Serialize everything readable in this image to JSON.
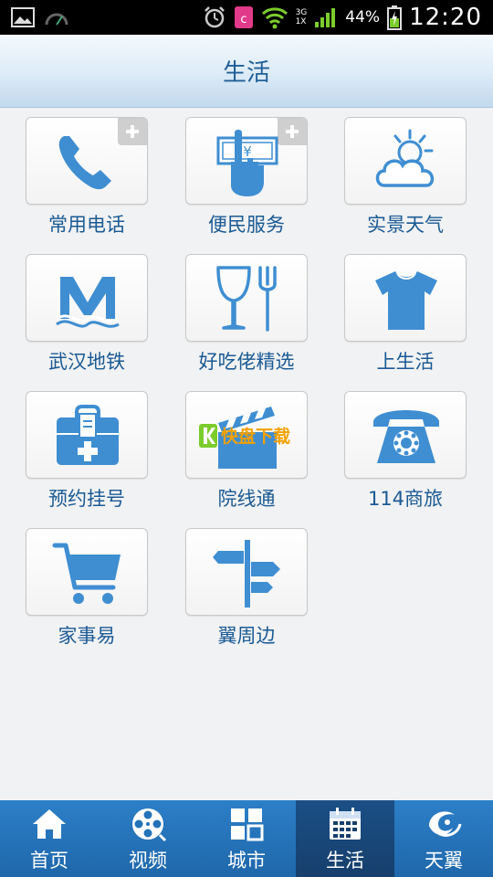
{
  "status_bar": {
    "battery_percent": "44%",
    "time": "12:20",
    "network_labels": [
      "3G",
      "1X"
    ],
    "icons": [
      "image-icon",
      "speedometer-icon",
      "alarm-clock-icon",
      "app-badge-icon",
      "wifi-icon",
      "signal-icon",
      "battery-icon"
    ]
  },
  "header": {
    "title": "生活"
  },
  "tiles": [
    {
      "label": "常用电话",
      "icon": "phone-handset-icon",
      "plus": true
    },
    {
      "label": "便民服务",
      "icon": "hand-with-yen-icon",
      "plus": true
    },
    {
      "label": "实景天气",
      "icon": "weather-sun-cloud-icon",
      "plus": false
    },
    {
      "label": "武汉地铁",
      "icon": "metro-m-icon",
      "plus": false
    },
    {
      "label": "好吃佬精选",
      "icon": "glass-fork-icon",
      "plus": false
    },
    {
      "label": "上生活",
      "icon": "tshirt-icon",
      "plus": false
    },
    {
      "label": "预约挂号",
      "icon": "medical-kit-icon",
      "plus": false
    },
    {
      "label": "院线通",
      "icon": "clapperboard-icon",
      "plus": false
    },
    {
      "label": "114商旅",
      "icon": "rotary-phone-icon",
      "plus": false
    },
    {
      "label": "家事易",
      "icon": "shopping-cart-icon",
      "plus": false
    },
    {
      "label": "翼周边",
      "icon": "signpost-icon",
      "plus": false
    }
  ],
  "watermark": {
    "text": "快盘下载"
  },
  "tab_bar": {
    "tabs": [
      {
        "label": "首页",
        "icon": "home-icon",
        "active": false
      },
      {
        "label": "视频",
        "icon": "film-reel-icon",
        "active": false
      },
      {
        "label": "城市",
        "icon": "grid-icon",
        "active": false
      },
      {
        "label": "生活",
        "icon": "calendar-icon",
        "active": true
      },
      {
        "label": "天翼",
        "icon": "tianyi-logo-icon",
        "active": false
      }
    ]
  },
  "colors": {
    "icon_blue": "#3f8ed2",
    "label_blue": "#1a5a94",
    "tab_bar": "#2472b8",
    "tab_active": "#173f6c"
  }
}
